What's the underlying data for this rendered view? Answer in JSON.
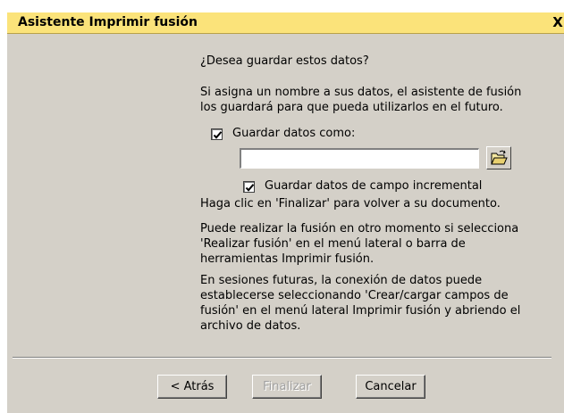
{
  "window": {
    "title": "Asistente Imprimir fusión",
    "close_glyph": "X"
  },
  "content": {
    "question": "¿Desea guardar estos datos?",
    "intro_line1": "Si asigna un nombre a sus datos, el asistente de fusión",
    "intro_line2": "los guardará para que pueda utilizarlos en el futuro.",
    "save_data_checkbox": {
      "label": "Guardar datos como:",
      "checked": true
    },
    "name_input": {
      "value": "",
      "placeholder": ""
    },
    "browse_icon": "open-folder-icon",
    "incremental_checkbox": {
      "label": "Guardar datos de campo incremental",
      "checked": true
    },
    "finish_hint": "Haga clic en 'Finalizar' para volver a su documento.",
    "later_line1": "Puede realizar la fusión en otro momento si selecciona",
    "later_line2": "'Realizar fusión' en el menú lateral o barra de",
    "later_line3": "herramientas Imprimir fusión.",
    "future_line1": "En sesiones futuras, la conexión de datos puede",
    "future_line2": "establecerse seleccionando 'Crear/cargar campos de",
    "future_line3": "fusión' en el menú lateral Imprimir fusión y abriendo el",
    "future_line4": "archivo de datos."
  },
  "buttons": {
    "back": "< Atrás",
    "finish": "Finalizar",
    "finish_enabled": false,
    "cancel": "Cancelar"
  },
  "colors": {
    "titlebar": "#fbe37a",
    "dialog_face": "#d4d0c8"
  }
}
